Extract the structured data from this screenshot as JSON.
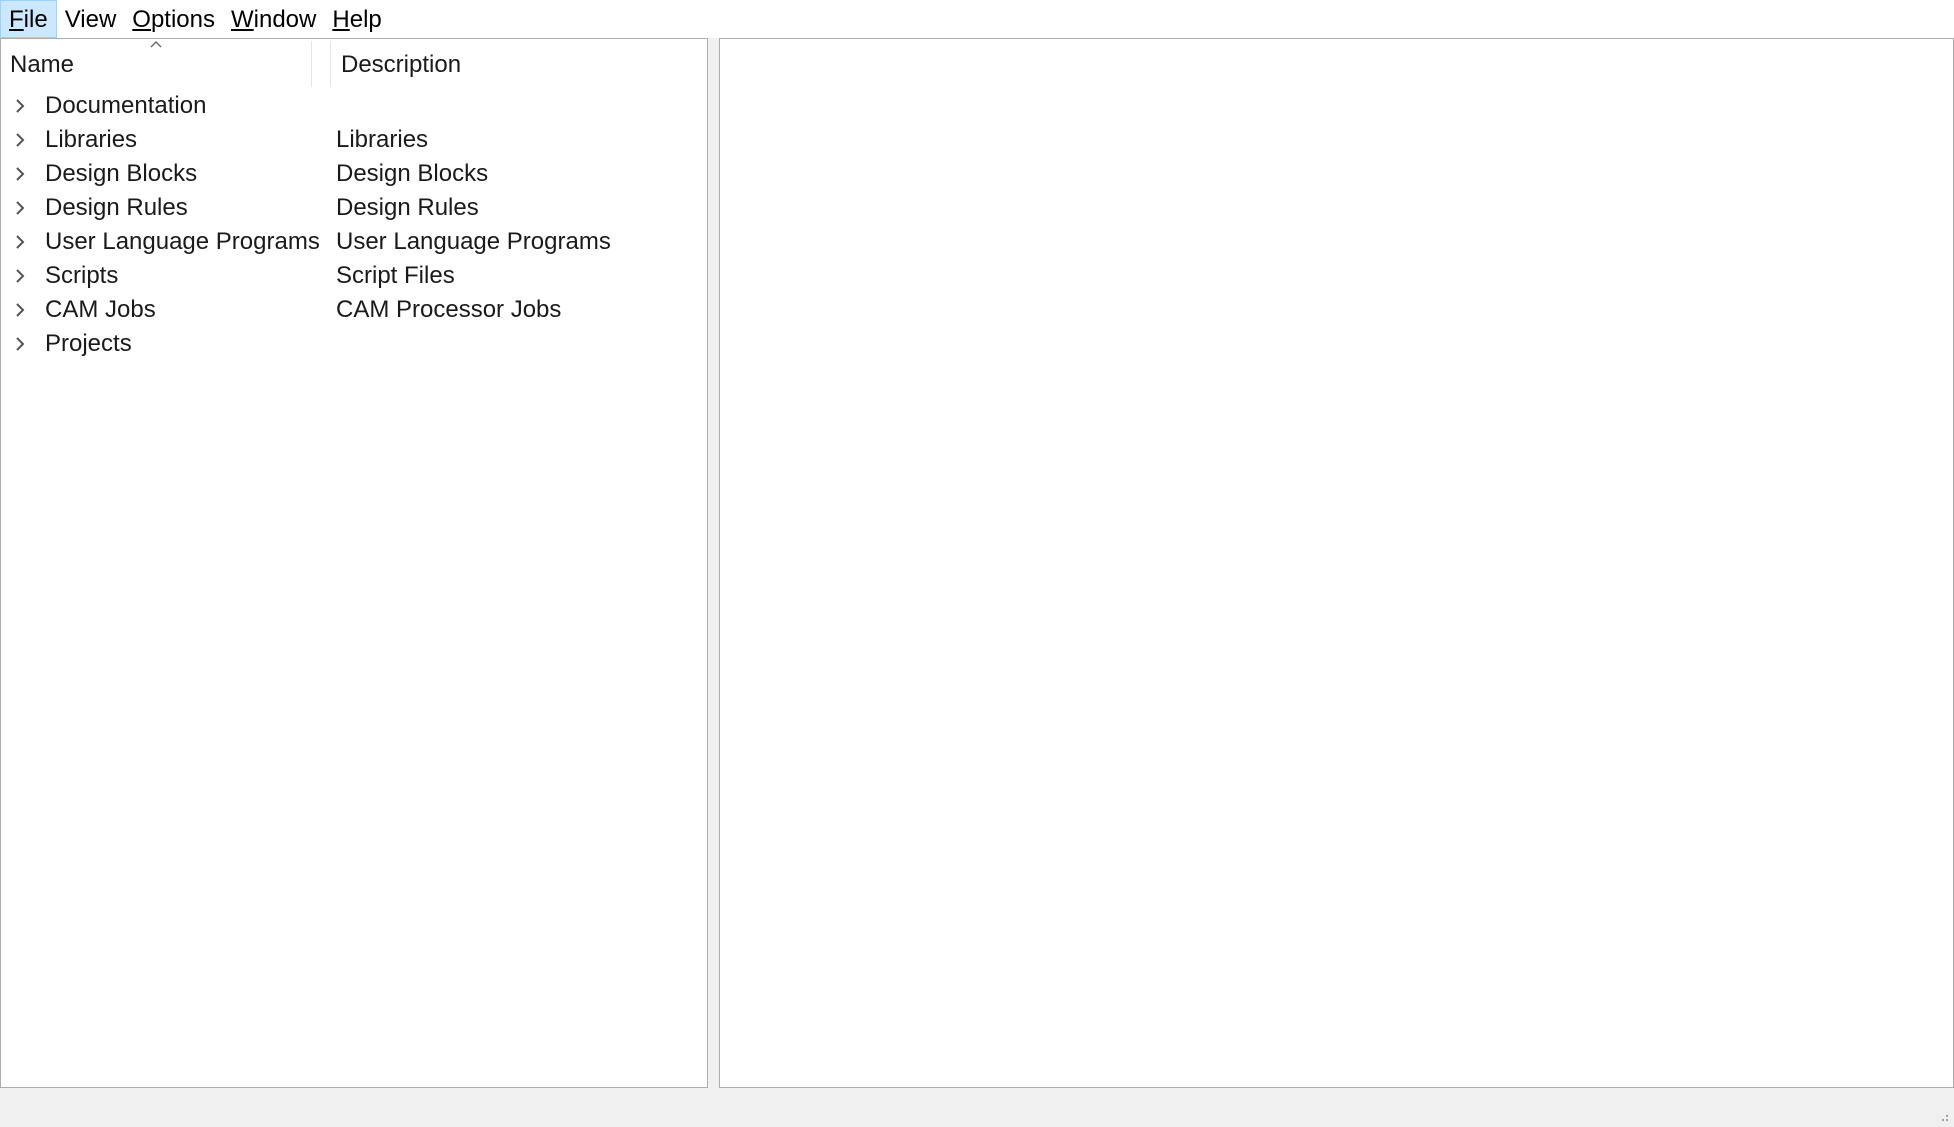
{
  "menu": {
    "items": [
      {
        "mnemonic": "F",
        "rest": "ile"
      },
      {
        "mnemonic": "",
        "rest": "View"
      },
      {
        "mnemonic": "O",
        "rest": "ptions"
      },
      {
        "mnemonic": "W",
        "rest": "indow"
      },
      {
        "mnemonic": "H",
        "rest": "elp"
      }
    ]
  },
  "tree": {
    "columns": {
      "name": "Name",
      "description": "Description"
    },
    "sort_icon": "sort-ascending-caret-icon",
    "expander_icon": "chevron-right-icon",
    "rows": [
      {
        "name": "Documentation",
        "description": ""
      },
      {
        "name": "Libraries",
        "description": "Libraries"
      },
      {
        "name": "Design Blocks",
        "description": "Design Blocks"
      },
      {
        "name": "Design Rules",
        "description": "Design Rules"
      },
      {
        "name": "User Language Programs",
        "description": "User Language Programs"
      },
      {
        "name": "Scripts",
        "description": "Script Files"
      },
      {
        "name": "CAM Jobs",
        "description": "CAM Processor Jobs"
      },
      {
        "name": "Projects",
        "description": ""
      }
    ]
  },
  "colors": {
    "active_menu_bg": "#cce8ff",
    "panel_border": "#adadad",
    "statusbar_bg": "#f0f0f0"
  }
}
